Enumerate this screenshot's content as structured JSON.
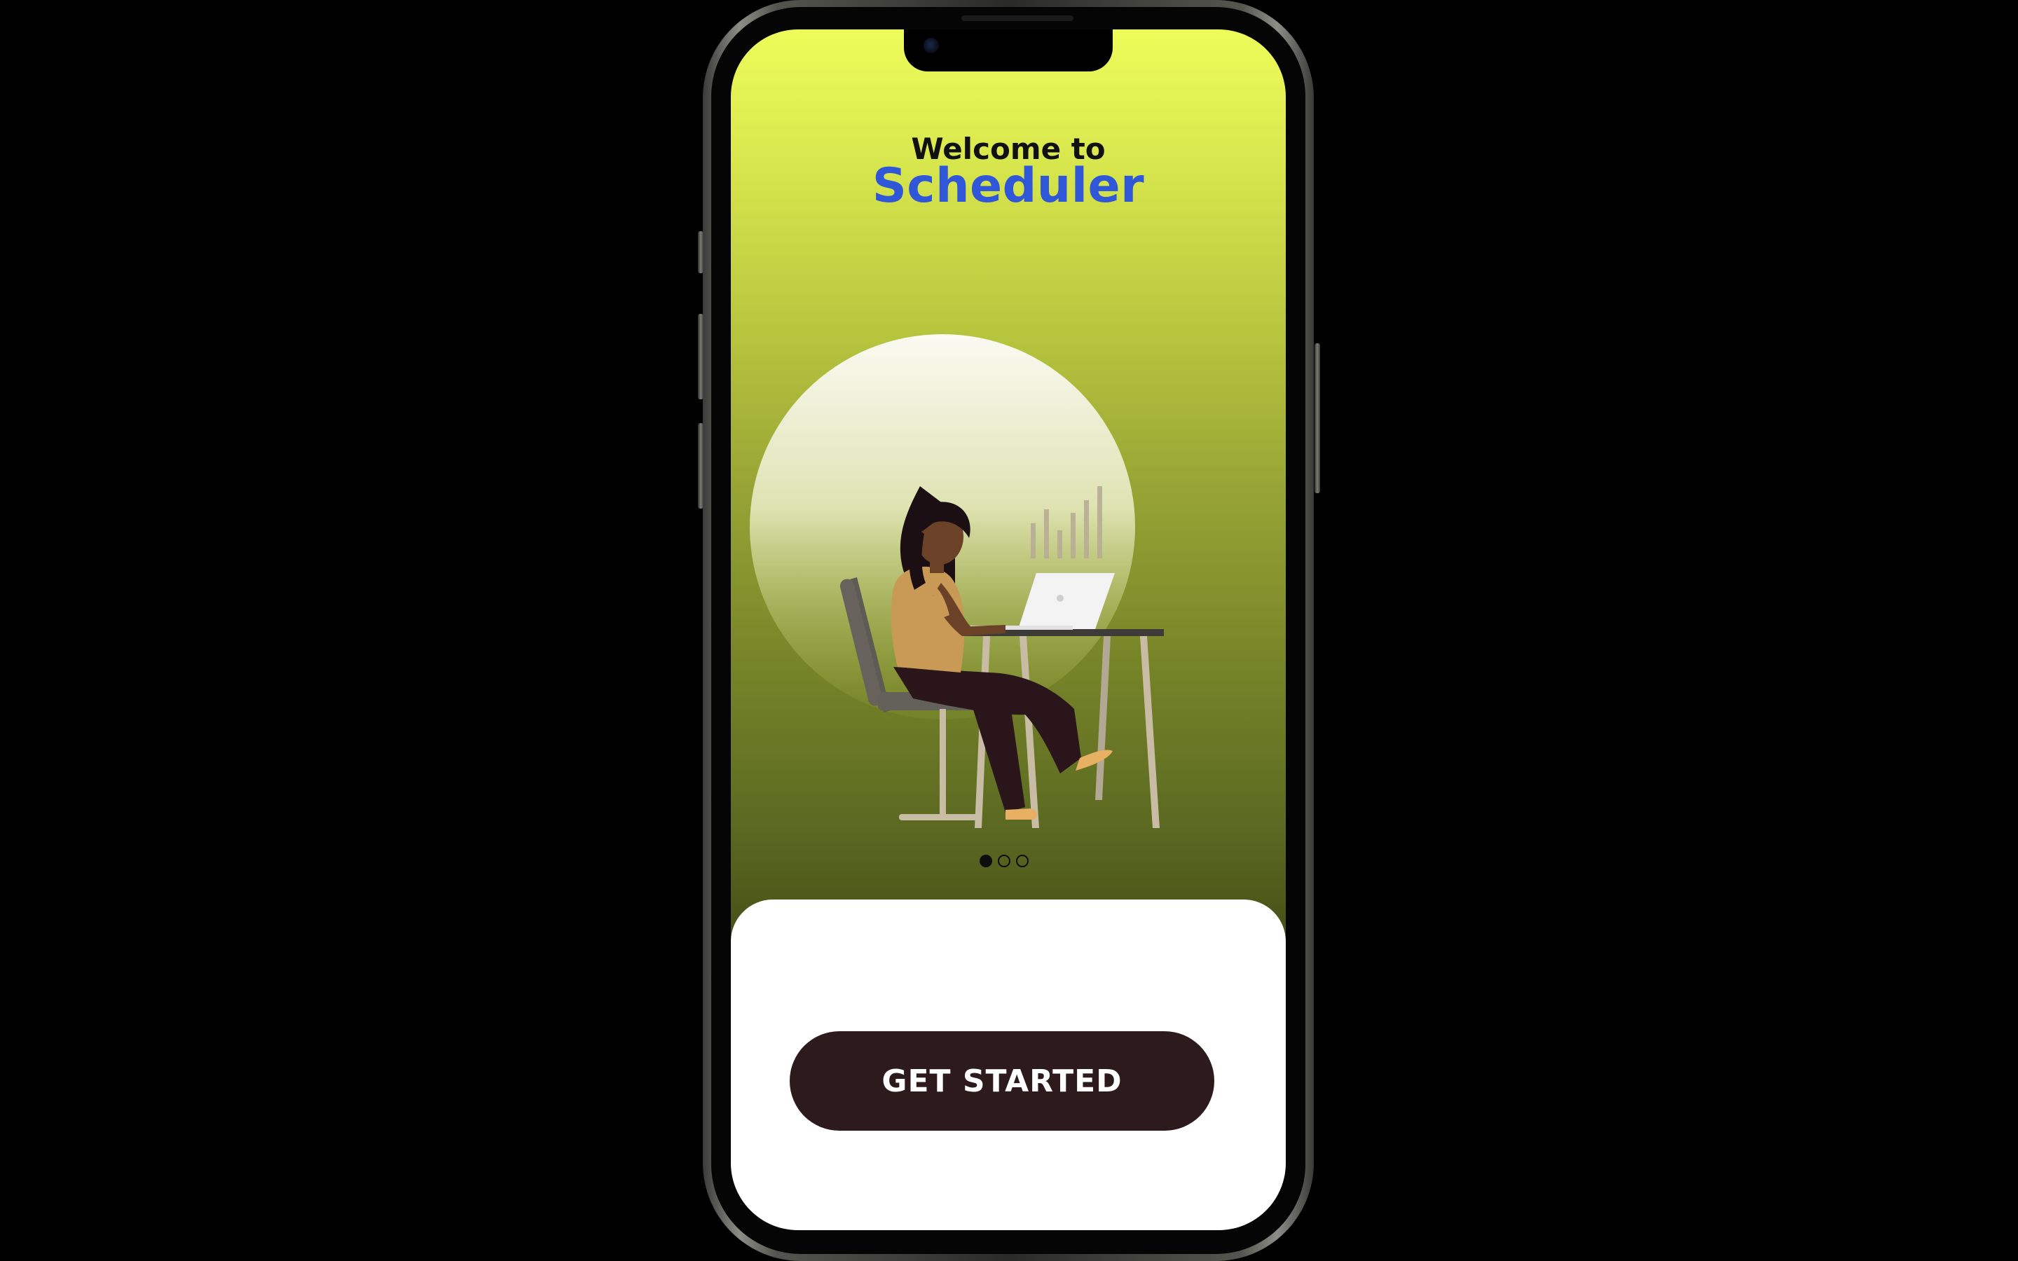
{
  "onboarding": {
    "welcome_text": "Welcome to",
    "app_name": "Scheduler",
    "illustration_alt": "",
    "pagination": {
      "total": 3,
      "active": 1
    },
    "cta_label": "GET STARTED"
  },
  "colors": {
    "gradient_top": "#eefc5a",
    "gradient_bottom": "#3d4413",
    "app_name": "#2f57d8",
    "button_bg": "#2d1a1c",
    "button_text": "#ffffff",
    "panel_bg": "#ffffff"
  },
  "icons": {
    "camera": "front-camera-icon",
    "illustration": "woman-at-laptop-illustration"
  }
}
